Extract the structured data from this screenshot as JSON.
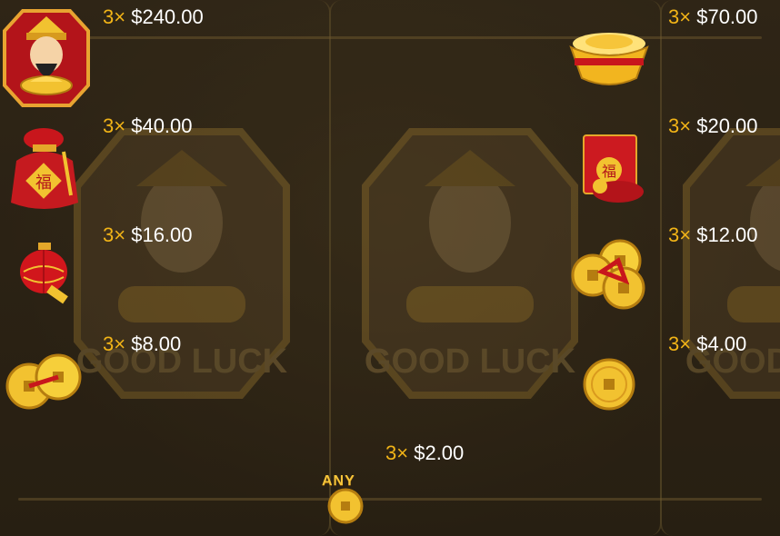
{
  "paytable": {
    "left": [
      {
        "symbol": "god-of-wealth-icon",
        "multiplier": "3×",
        "amount": "$240.00"
      },
      {
        "symbol": "red-pouch-icon",
        "multiplier": "3×",
        "amount": "$40.00"
      },
      {
        "symbol": "red-lantern-icon",
        "multiplier": "3×",
        "amount": "$16.00"
      },
      {
        "symbol": "two-coins-icon",
        "multiplier": "3×",
        "amount": "$8.00"
      }
    ],
    "right": [
      {
        "symbol": "gold-ingot-icon",
        "multiplier": "3×",
        "amount": "$70.00"
      },
      {
        "symbol": "red-envelope-icon",
        "multiplier": "3×",
        "amount": "$20.00"
      },
      {
        "symbol": "three-coins-icon",
        "multiplier": "3×",
        "amount": "$12.00"
      },
      {
        "symbol": "single-coin-icon",
        "multiplier": "3×",
        "amount": "$4.00"
      }
    ],
    "center": {
      "symbol": "any-coin-icon",
      "label": "ANY",
      "multiplier": "3×",
      "amount": "$2.00"
    }
  },
  "background": {
    "watermark_text": "GOOD LUCK"
  },
  "colors": {
    "multiplier": "#f2b417",
    "amount": "#ffffff",
    "background": "#2a2114"
  }
}
